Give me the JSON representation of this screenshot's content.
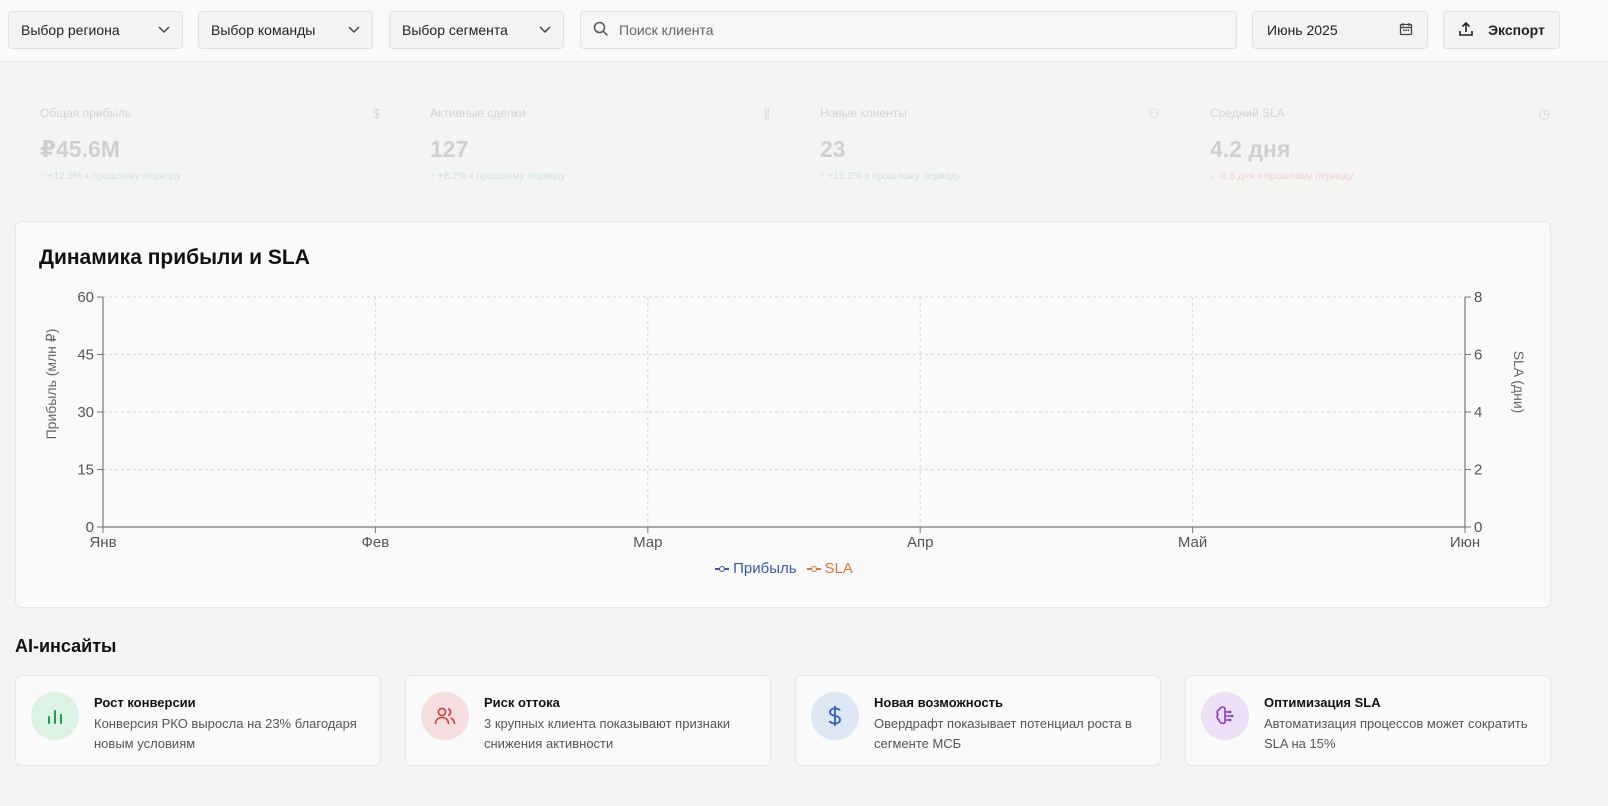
{
  "toolbar": {
    "region_label": "Выбор региона",
    "team_label": "Выбор команды",
    "segment_label": "Выбор сегмента",
    "search_placeholder": "Поиск клиента",
    "date_label": "Июнь 2025",
    "export_label": "Экспорт"
  },
  "kpis": [
    {
      "label": "Общая прибыль",
      "icon": "$",
      "value": "₽45.6M",
      "delta": "↑ +12.5% к прошлому периоду",
      "trend": "up"
    },
    {
      "label": "Активные сделки",
      "icon": "⫼",
      "value": "127",
      "delta": "↑ +8.2% к прошлому периоду",
      "trend": "up"
    },
    {
      "label": "Новые клиенты",
      "icon": "⚇",
      "value": "23",
      "delta": "↑ +15.3% к прошлому периоду",
      "trend": "up"
    },
    {
      "label": "Средний SLA",
      "icon": "◷",
      "value": "4.2 дня",
      "delta": "↓ -0.8 дня к прошлому периоду",
      "trend": "down"
    }
  ],
  "chart": {
    "title": "Динамика прибыли и SLA"
  },
  "chart_data": {
    "type": "line",
    "title": "Динамика прибыли и SLA",
    "categories": [
      "Янв",
      "Фев",
      "Мар",
      "Апр",
      "Май",
      "Июн"
    ],
    "xlabel": "",
    "ylabel": "Прибыль (млн ₽)",
    "y2label": "SLA (дни)",
    "ylim": [
      0,
      60
    ],
    "y2lim": [
      0,
      8
    ],
    "yticks": [
      0,
      15,
      30,
      45,
      60
    ],
    "y2ticks": [
      0,
      2,
      4,
      6,
      8
    ],
    "grid": true,
    "legend_position": "bottom",
    "series": [
      {
        "name": "Прибыль",
        "axis": "left",
        "color": "#3b5ba9",
        "values": []
      },
      {
        "name": "SLA",
        "axis": "right",
        "color": "#d9773b",
        "values": []
      }
    ]
  },
  "insights": {
    "title": "AI-инсайты",
    "cards": [
      {
        "title": "Рост конверсии",
        "text": "Конверсия РКО выросла на 23% благодаря новым условиям",
        "icon": "bar-chart-icon",
        "color": "#1f9d55",
        "bg": "#dcf3e4"
      },
      {
        "title": "Риск оттока",
        "text": "3 крупных клиента показывают признаки снижения активности",
        "icon": "users-icon",
        "color": "#d13b3b",
        "bg": "#f7dede"
      },
      {
        "title": "Новая возможность",
        "text": "Овердрафт показывает потенциал роста в сегменте МСБ",
        "icon": "dollar-icon",
        "color": "#2f5fb3",
        "bg": "#dde6f5"
      },
      {
        "title": "Оптимизация SLA",
        "text": "Автоматизация процессов может сократить SLA на 15%",
        "icon": "brain-icon",
        "color": "#8b3fc9",
        "bg": "#ecdff6"
      }
    ]
  }
}
